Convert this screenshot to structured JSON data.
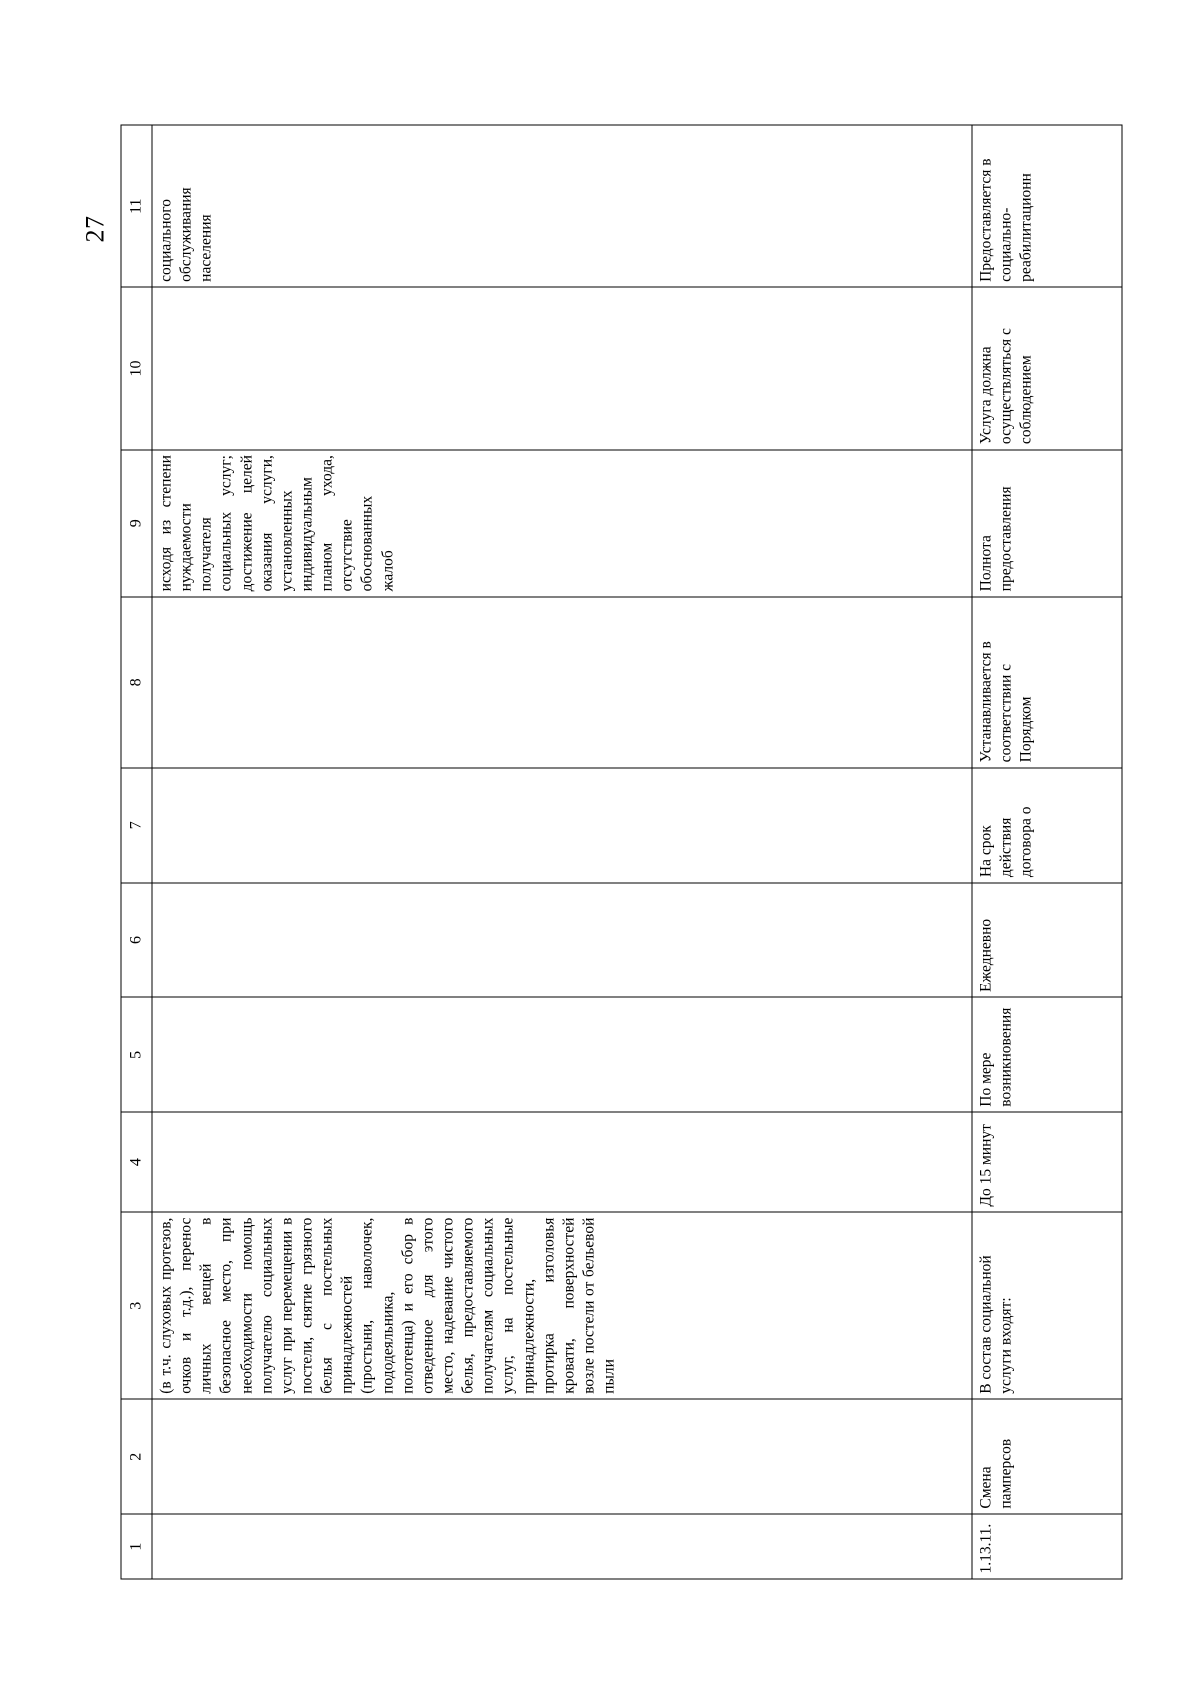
{
  "page": {
    "number": "27"
  },
  "table": {
    "column_numbers": [
      "1",
      "2",
      "3",
      "4",
      "5",
      "6",
      "7",
      "8",
      "9",
      "10",
      "11"
    ],
    "rows": [
      {
        "name": "continuation-row",
        "c1": "",
        "c2": "",
        "c3": "(в т.ч. слуховых протезов, очков и т.д.), перенос личных вещей в безопасное место, при необходимости помощь получателю социальных услуг при перемещении в постели, снятие грязного белья с постельных принадлежностей (простыни, наволочек, пододеяльника, полотенца) и его сбор в отведенное для этого место, надевание чистого белья, предоставляемого получателям социальных услуг, на постельные принадлежности, протирка изголовья кровати, поверхностей возле постели от бельевой пыли",
        "c4": "",
        "c5": "",
        "c6": "",
        "c7": "",
        "c8": "",
        "c9": "исходя из степени нуждаемости получателя социальных услуг; достижение целей оказания услуги, установленных индивидуальным планом ухода, отсутствие обоснованных жалоб",
        "c10": "",
        "c11": "социального обслуживания населения"
      },
      {
        "name": "row-1-13-11",
        "c1": "1.13.11.",
        "c2": "Смена памперсов",
        "c3": "В состав социальной услуги входят:",
        "c4": "До 15 минут",
        "c5": "По мере возникновения",
        "c6": "Ежедневно",
        "c7": "На срок действия договора о",
        "c8": "Устанавливается в соответствии с Порядком",
        "c9": "Полнота предоставления",
        "c10": "Услуга должна осуществляться с соблюдением",
        "c11": "Предоставляется в социально-реабилитационн"
      }
    ]
  }
}
